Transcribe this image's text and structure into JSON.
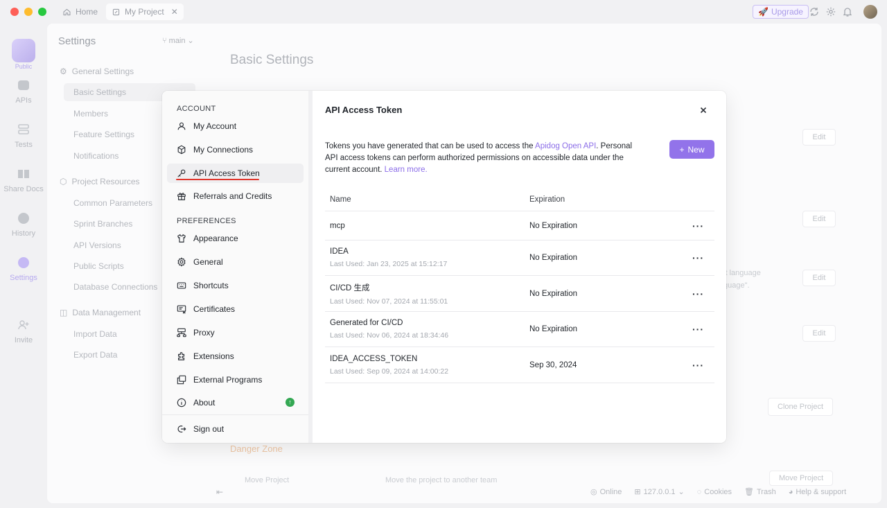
{
  "titlebar": {
    "tabs": [
      {
        "label": "Home"
      },
      {
        "label": "My Project"
      }
    ],
    "upgrade_label": "Upgrade"
  },
  "rail": {
    "logo_label": "Public",
    "items": [
      {
        "label": "APIs"
      },
      {
        "label": "Tests"
      },
      {
        "label": "Share Docs"
      },
      {
        "label": "History"
      },
      {
        "label": "Settings"
      },
      {
        "label": "Invite"
      }
    ]
  },
  "settings": {
    "title": "Settings",
    "branch": "main",
    "page_title": "Basic Settings",
    "groups": [
      {
        "label": "General Settings",
        "items": [
          "Basic Settings",
          "Members",
          "Feature Settings",
          "Notifications"
        ]
      },
      {
        "label": "Project Resources",
        "items": [
          "Common Parameters",
          "Sprint Branches",
          "API Versions",
          "Public Scripts",
          "Database Connections"
        ]
      },
      {
        "label": "Data Management",
        "items": [
          "Import Data",
          "Export Data"
        ]
      }
    ],
    "edit_label": "Edit",
    "clone_label": "Clone Project",
    "move_label": "Move Project",
    "danger_zone": "Danger Zone",
    "move_desc": "Move the project to another team",
    "lang_fragment_1": "lt language",
    "lang_fragment_2": "guage\"."
  },
  "statusbar": {
    "online": "Online",
    "host": "127.0.0.1",
    "cookies": "Cookies",
    "trash": "Trash",
    "help": "Help & support"
  },
  "modal": {
    "account_head": "ACCOUNT",
    "account_items": [
      "My Account",
      "My Connections",
      "API Access Token",
      "Referrals and Credits"
    ],
    "pref_head": "PREFERENCES",
    "pref_items": [
      "Appearance",
      "General",
      "Shortcuts",
      "Certificates",
      "Proxy",
      "Extensions",
      "External Programs",
      "About"
    ],
    "sign_out": "Sign out",
    "title": "API Access Token",
    "desc_pre": "Tokens you have generated that can be used to access the ",
    "desc_link": "Apidog Open API",
    "desc_post": ". Personal API access tokens can perform authorized permissions on accessible data under the current account. ",
    "learn_more": "Learn more.",
    "new_label": "New",
    "col_name": "Name",
    "col_exp": "Expiration",
    "tokens": [
      {
        "name": "mcp",
        "last_used": "",
        "expiration": "No Expiration"
      },
      {
        "name": "IDEA",
        "last_used": "Last Used:  Jan 23, 2025 at 15:12:17",
        "expiration": "No Expiration"
      },
      {
        "name": "CI/CD 生成",
        "last_used": "Last Used:  Nov 07, 2024 at 11:55:01",
        "expiration": "No Expiration"
      },
      {
        "name": "Generated for CI/CD",
        "last_used": "Last Used:  Nov 06, 2024 at 18:34:46",
        "expiration": "No Expiration"
      },
      {
        "name": "IDEA_ACCESS_TOKEN",
        "last_used": "Last Used:  Sep 09, 2024 at 14:00:22",
        "expiration": "Sep 30, 2024"
      }
    ]
  },
  "colors": {
    "accent": "#9273ea",
    "link": "#8b6de8",
    "underline": "#e0352b",
    "badge": "#34a853"
  }
}
